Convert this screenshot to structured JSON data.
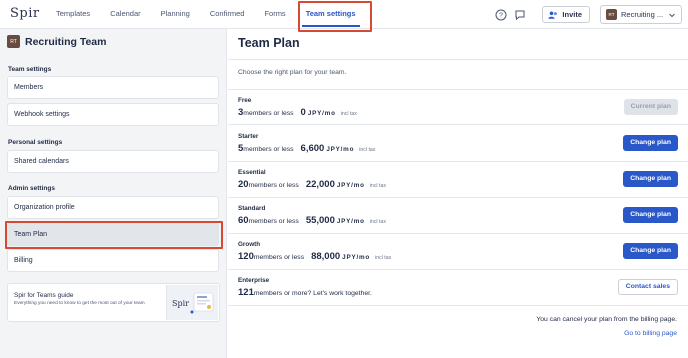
{
  "app": {
    "logo": "Spir"
  },
  "nav": {
    "items": [
      "Templates",
      "Calendar",
      "Planning",
      "Confirmed",
      "Forms",
      "Team settings"
    ],
    "active": "Team settings"
  },
  "topbar": {
    "help_icon": "help-circle-icon",
    "chat_icon": "chat-icon",
    "invite_label": "Invite",
    "team_avatar": "RT",
    "team_name": "Recruiting ..."
  },
  "sidebar": {
    "team_avatar": "RT",
    "team_title": "Recruiting Team",
    "sections": [
      {
        "label": "Team settings",
        "items": [
          "Members",
          "Webhook settings"
        ]
      },
      {
        "label": "Personal settings",
        "items": [
          "Shared calendars"
        ]
      },
      {
        "label": "Admin settings",
        "items": [
          "Organization profile",
          "Team Plan",
          "Billing"
        ]
      }
    ],
    "active_item": "Team Plan",
    "guide": {
      "title": "Spir for Teams guide",
      "description": "Everything you need to know to get the most out of your team",
      "thumb_logo": "Spir"
    }
  },
  "main": {
    "title": "Team Plan",
    "subtitle": "Choose the right plan for your team.",
    "plans": [
      {
        "name": "Free",
        "members": "3",
        "members_text": "members or less",
        "price": "0",
        "currency": "JPY/mo",
        "tax": "incl tax",
        "button": "Current plan",
        "button_state": "disabled"
      },
      {
        "name": "Starter",
        "members": "5",
        "members_text": "members or less",
        "price": "6,600",
        "currency": "JPY/mo",
        "tax": "incl tax",
        "button": "Change plan",
        "button_state": "primary"
      },
      {
        "name": "Essential",
        "members": "20",
        "members_text": "members or less",
        "price": "22,000",
        "currency": "JPY/mo",
        "tax": "incl tax",
        "button": "Change plan",
        "button_state": "primary"
      },
      {
        "name": "Standard",
        "members": "60",
        "members_text": "members or less",
        "price": "55,000",
        "currency": "JPY/mo",
        "tax": "incl tax",
        "button": "Change plan",
        "button_state": "primary"
      },
      {
        "name": "Growth",
        "members": "120",
        "members_text": "members or less",
        "price": "88,000",
        "currency": "JPY/mo",
        "tax": "incl tax",
        "button": "Change plan",
        "button_state": "primary"
      },
      {
        "name": "Enterprise",
        "members": "121",
        "members_text": "members or more? Let's work together.",
        "price": "",
        "currency": "",
        "tax": "",
        "button": "Contact sales",
        "button_state": "outline"
      }
    ],
    "cancel_note": "You can cancel your plan from the billing page.",
    "billing_link": "Go to billing page"
  },
  "colors": {
    "accent": "#2b58c8",
    "highlight": "#d64a34",
    "sidebar_bg": "#f3f4f6"
  }
}
